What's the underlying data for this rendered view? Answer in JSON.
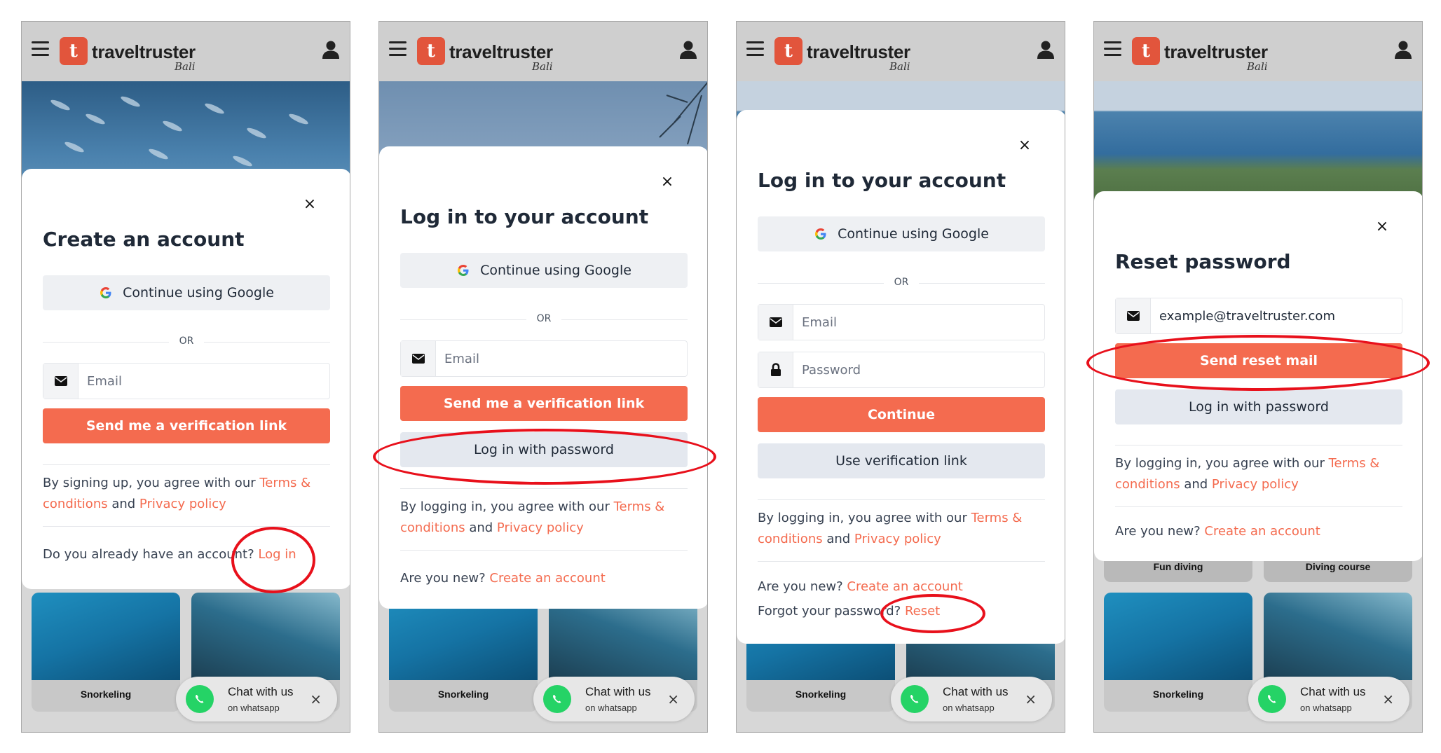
{
  "brand": {
    "name": "traveltruster",
    "sub": "Bali",
    "badge": "t"
  },
  "colors": {
    "accent": "#f46b4f",
    "annotation": "#e8101b",
    "whatsapp": "#25d366"
  },
  "tiles": {
    "fun_diving": "Fun diving",
    "diving_course": "Diving course",
    "snorkeling": "Snorkeling",
    "freediving": ""
  },
  "chat": {
    "title": "Chat with us",
    "sub": "on whatsapp",
    "close": "×"
  },
  "panels": {
    "p1": {
      "title": "Create an account",
      "close": "×",
      "google": "Continue using Google",
      "or": "OR",
      "email_placeholder": "Email",
      "primary": "Send me a verification link",
      "legal_prefix": "By signing up, you agree with our ",
      "terms": "Terms & conditions",
      "and": " and ",
      "privacy": "Privacy policy",
      "bottom_prefix": "Do you already have an account? ",
      "bottom_link": "Log in"
    },
    "p2": {
      "title": "Log in to your account",
      "close": "×",
      "google": "Continue using Google",
      "or": "OR",
      "email_placeholder": "Email",
      "primary": "Send me a verification link",
      "secondary": "Log in with password",
      "legal_prefix": "By logging in, you agree with our ",
      "terms": "Terms & conditions",
      "and": " and ",
      "privacy": "Privacy policy",
      "bottom_prefix": "Are you new? ",
      "bottom_link": "Create an account"
    },
    "p3": {
      "title": "Log in to your account",
      "close": "×",
      "google": "Continue using Google",
      "or": "OR",
      "email_placeholder": "Email",
      "password_placeholder": "Password",
      "primary": "Continue",
      "secondary": "Use verification link",
      "legal_prefix": "By logging in, you agree with our ",
      "terms": "Terms & conditions",
      "and": " and ",
      "privacy": "Privacy policy",
      "bottom_prefix": "Are you new? ",
      "bottom_link": "Create an account",
      "forgot_prefix": "Forgot your password? ",
      "forgot_link": "Reset"
    },
    "p4": {
      "title": "Reset password",
      "close": "×",
      "email_value": "example@traveltruster.com",
      "primary": "Send reset mail",
      "secondary": "Log in with password",
      "legal_prefix": "By logging in, you agree with our ",
      "terms": "Terms & conditions",
      "and": " and ",
      "privacy": "Privacy policy",
      "bottom_prefix": "Are you new? ",
      "bottom_link": "Create an account"
    }
  }
}
